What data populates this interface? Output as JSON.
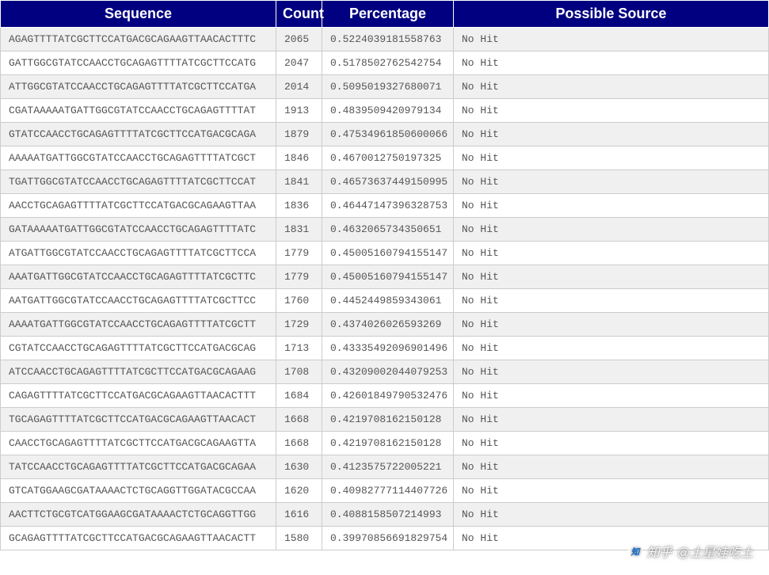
{
  "headers": {
    "sequence": "Sequence",
    "count": "Count",
    "percentage": "Percentage",
    "source": "Possible Source"
  },
  "rows": [
    {
      "sequence": "AGAGTTTTATCGCTTCCATGACGCAGAAGTTAACACTTTC",
      "count": "2065",
      "percentage": "0.5224039181558763",
      "source": "No Hit"
    },
    {
      "sequence": "GATTGGCGTATCCAACCTGCAGAGTTTTATCGCTTCCATG",
      "count": "2047",
      "percentage": "0.5178502762542754",
      "source": "No Hit"
    },
    {
      "sequence": "ATTGGCGTATCCAACCTGCAGAGTTTTATCGCTTCCATGA",
      "count": "2014",
      "percentage": "0.5095019327680071",
      "source": "No Hit"
    },
    {
      "sequence": "CGATAAAAATGATTGGCGTATCCAACCTGCAGAGTTTTAT",
      "count": "1913",
      "percentage": "0.4839509420979134",
      "source": "No Hit"
    },
    {
      "sequence": "GTATCCAACCTGCAGAGTTTTATCGCTTCCATGACGCAGA",
      "count": "1879",
      "percentage": "0.47534961850600066",
      "source": "No Hit"
    },
    {
      "sequence": "AAAAATGATTGGCGTATCCAACCTGCAGAGTTTTATCGCT",
      "count": "1846",
      "percentage": "0.4670012750197325",
      "source": "No Hit"
    },
    {
      "sequence": "TGATTGGCGTATCCAACCTGCAGAGTTTTATCGCTTCCAT",
      "count": "1841",
      "percentage": "0.46573637449150995",
      "source": "No Hit"
    },
    {
      "sequence": "AACCTGCAGAGTTTTATCGCTTCCATGACGCAGAAGTTAA",
      "count": "1836",
      "percentage": "0.46447147396328753",
      "source": "No Hit"
    },
    {
      "sequence": "GATAAAAATGATTGGCGTATCCAACCTGCAGAGTTTTATC",
      "count": "1831",
      "percentage": "0.4632065734350651",
      "source": "No Hit"
    },
    {
      "sequence": "ATGATTGGCGTATCCAACCTGCAGAGTTTTATCGCTTCCA",
      "count": "1779",
      "percentage": "0.45005160794155147",
      "source": "No Hit"
    },
    {
      "sequence": "AAATGATTGGCGTATCCAACCTGCAGAGTTTTATCGCTTC",
      "count": "1779",
      "percentage": "0.45005160794155147",
      "source": "No Hit"
    },
    {
      "sequence": "AATGATTGGCGTATCCAACCTGCAGAGTTTTATCGCTTCC",
      "count": "1760",
      "percentage": "0.4452449859343061",
      "source": "No Hit"
    },
    {
      "sequence": "AAAATGATTGGCGTATCCAACCTGCAGAGTTTTATCGCTT",
      "count": "1729",
      "percentage": "0.4374026026593269",
      "source": "No Hit"
    },
    {
      "sequence": "CGTATCCAACCTGCAGAGTTTTATCGCTTCCATGACGCAG",
      "count": "1713",
      "percentage": "0.43335492096901496",
      "source": "No Hit"
    },
    {
      "sequence": "ATCCAACCTGCAGAGTTTTATCGCTTCCATGACGCAGAAG",
      "count": "1708",
      "percentage": "0.43209002044079253",
      "source": "No Hit"
    },
    {
      "sequence": "CAGAGTTTTATCGCTTCCATGACGCAGAAGTTAACACTTT",
      "count": "1684",
      "percentage": "0.42601849790532476",
      "source": "No Hit"
    },
    {
      "sequence": "TGCAGAGTTTTATCGCTTCCATGACGCAGAAGTTAACACT",
      "count": "1668",
      "percentage": "0.4219708162150128",
      "source": "No Hit"
    },
    {
      "sequence": "CAACCTGCAGAGTTTTATCGCTTCCATGACGCAGAAGTTA",
      "count": "1668",
      "percentage": "0.4219708162150128",
      "source": "No Hit"
    },
    {
      "sequence": "TATCCAACCTGCAGAGTTTTATCGCTTCCATGACGCAGAA",
      "count": "1630",
      "percentage": "0.4123575722005221",
      "source": "No Hit"
    },
    {
      "sequence": "GTCATGGAAGCGATAAAACTCTGCAGGTTGGATACGCCAA",
      "count": "1620",
      "percentage": "0.40982777114407726",
      "source": "No Hit"
    },
    {
      "sequence": "AACTTCTGCGTCATGGAAGCGATAAAACTCTGCAGGTTGG",
      "count": "1616",
      "percentage": "0.4088158507214993",
      "source": "No Hit"
    },
    {
      "sequence": "GCAGAGTTTTATCGCTTCCATGACGCAGAAGTTAACACTT",
      "count": "1580",
      "percentage": "0.39970856691829754",
      "source": "No Hit"
    }
  ],
  "watermark": {
    "prefix": "知乎",
    "text": "@土星娃吃土"
  }
}
